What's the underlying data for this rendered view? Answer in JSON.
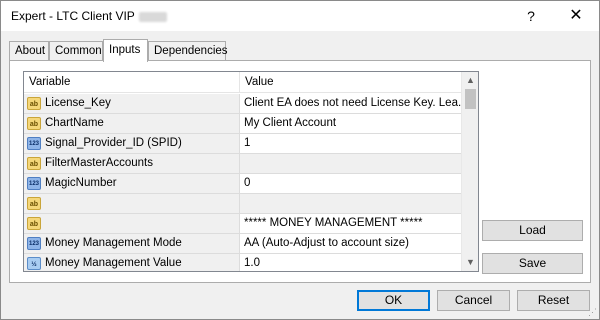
{
  "window": {
    "title": "Expert - LTC Client VIP",
    "help_glyph": "?",
    "close_glyph": "✕"
  },
  "tabs": [
    {
      "label": "About",
      "active": false
    },
    {
      "label": "Common",
      "active": false
    },
    {
      "label": "Inputs",
      "active": true
    },
    {
      "label": "Dependencies",
      "active": false
    }
  ],
  "grid": {
    "headers": {
      "variable": "Variable",
      "value": "Value"
    },
    "rows": [
      {
        "type": "ab",
        "icon_text": "ab",
        "variable": "License_Key",
        "value": "Client EA does not need License Key. Lea..."
      },
      {
        "type": "ab",
        "icon_text": "ab",
        "variable": "ChartName",
        "value": "My Client Account"
      },
      {
        "type": "123",
        "icon_text": "123",
        "variable": "Signal_Provider_ID (SPID)",
        "value": "1"
      },
      {
        "type": "ab",
        "icon_text": "ab",
        "variable": "FilterMasterAccounts",
        "value": ""
      },
      {
        "type": "123",
        "icon_text": "123",
        "variable": "MagicNumber",
        "value": "0"
      },
      {
        "type": "ab",
        "icon_text": "ab",
        "variable": "",
        "value": ""
      },
      {
        "type": "ab",
        "icon_text": "ab",
        "variable": "",
        "value": "***** MONEY MANAGEMENT *****"
      },
      {
        "type": "123",
        "icon_text": "123",
        "variable": "Money Management Mode",
        "value": "AA (Auto-Adjust to account size)"
      },
      {
        "type": "frac",
        "icon_text": "½",
        "variable": "Money Management Value",
        "value": "1.0"
      }
    ],
    "scroll_up_glyph": "▲",
    "scroll_down_glyph": "▼"
  },
  "buttons": {
    "load": "Load",
    "save": "Save",
    "ok": "OK",
    "cancel": "Cancel",
    "reset": "Reset"
  },
  "colors": {
    "accent": "#0078d7",
    "string_icon": "#f5d77a",
    "numeric_icon": "#8fb5e8"
  }
}
